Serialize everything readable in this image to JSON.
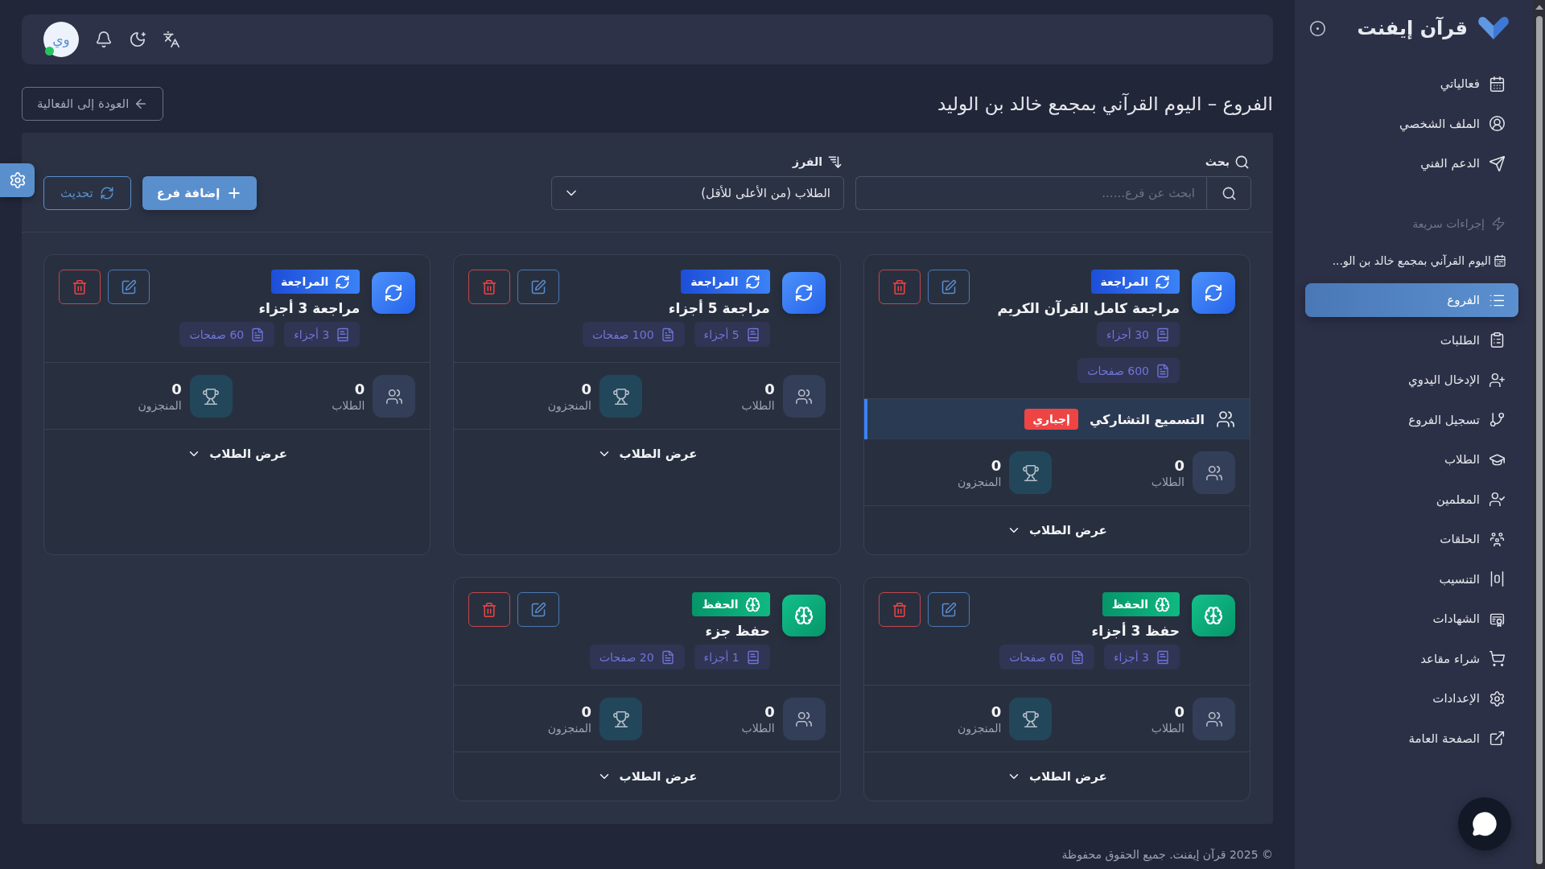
{
  "sidebar": {
    "brand": "قرآن إيفنت",
    "items": [
      {
        "label": "فعالياتي",
        "selected": false
      },
      {
        "label": "الملف الشخصي",
        "selected": false
      },
      {
        "label": "الدعم الفني",
        "selected": false
      }
    ],
    "quick_actions": {
      "title": "إجراءات سريعة",
      "event": "اليوم القرآني بمجمع خالد بن الو...",
      "items": [
        {
          "label": "الفروع",
          "selected": true
        },
        {
          "label": "الطلبات",
          "selected": false
        },
        {
          "label": "الإدخال اليدوي",
          "selected": false
        },
        {
          "label": "تسجيل الفروع",
          "selected": false
        },
        {
          "label": "الطلاب",
          "selected": false
        },
        {
          "label": "المعلمين",
          "selected": false
        },
        {
          "label": "الحلقات",
          "selected": false
        },
        {
          "label": "التنسيب",
          "selected": false
        },
        {
          "label": "الشهادات",
          "selected": false
        },
        {
          "label": "شراء مقاعد",
          "selected": false
        },
        {
          "label": "الإعدادات",
          "selected": false
        },
        {
          "label": "الصفحة العامة",
          "selected": false
        }
      ]
    }
  },
  "top_bar": {
    "avatar": "وي",
    "online": true
  },
  "page": {
    "title": "الفروع – اليوم القرآني بمجمع خالد بن الوليد",
    "back_button": "العودة إلى الفعالية"
  },
  "toolbar": {
    "search": {
      "label": "بحث",
      "placeholder": "ابحث عن فرع......"
    },
    "sort": {
      "label": "الفرز",
      "value": "الطلاب (من الأعلى للأقل)"
    },
    "add_button": "إضافة فرع",
    "refresh_button": "تحديث"
  },
  "branches": [
    {
      "kind": "review",
      "type_label": "المراجعة",
      "title": "مراجعة كامل القرآن الكريم",
      "parts": "30 أجزاء",
      "pages": "600 صفحات",
      "group_recitation": {
        "label": "التسميع التشاركي",
        "badge": "إجباري"
      },
      "stats": [
        {
          "kind": "students",
          "value": "0",
          "label": "الطلاب"
        },
        {
          "kind": "achievers",
          "value": "0",
          "label": "المنجزون"
        }
      ],
      "toggle": "عرض الطلاب",
      "expanded": false
    },
    {
      "kind": "review",
      "type_label": "المراجعة",
      "title": "مراجعة 5 أجزاء",
      "parts": "5 أجزاء",
      "pages": "100 صفحات",
      "stats": [
        {
          "kind": "students",
          "value": "0",
          "label": "الطلاب"
        },
        {
          "kind": "achievers",
          "value": "0",
          "label": "المنجزون"
        }
      ],
      "toggle": "عرض الطلاب",
      "expanded": false
    },
    {
      "kind": "review",
      "type_label": "المراجعة",
      "title": "مراجعة 3 أجزاء",
      "parts": "3 أجزاء",
      "pages": "60 صفحات",
      "stats": [
        {
          "kind": "students",
          "value": "0",
          "label": "الطلاب"
        },
        {
          "kind": "achievers",
          "value": "0",
          "label": "المنجزون"
        }
      ],
      "toggle": "عرض الطلاب",
      "expanded": false
    },
    {
      "kind": "memorization",
      "type_label": "الحفظ",
      "title": "حفظ 3 أجزاء",
      "parts": "3 أجزاء",
      "pages": "60 صفحات",
      "stats": [
        {
          "kind": "students",
          "value": "0",
          "label": "الطلاب"
        },
        {
          "kind": "achievers",
          "value": "0",
          "label": "المنجزون"
        }
      ],
      "toggle": "عرض الطلاب",
      "expanded": false
    },
    {
      "kind": "memorization",
      "type_label": "الحفظ",
      "title": "حفظ جزء",
      "parts": "1 أجزاء",
      "pages": "20 صفحات",
      "stats": [
        {
          "kind": "students",
          "value": "0",
          "label": "الطلاب"
        },
        {
          "kind": "achievers",
          "value": "0",
          "label": "المنجزون"
        }
      ],
      "toggle": "عرض الطلاب",
      "expanded": false
    }
  ],
  "footer": "© 2025 قرآن إيفنت. جميع الحقوق محفوظة"
}
